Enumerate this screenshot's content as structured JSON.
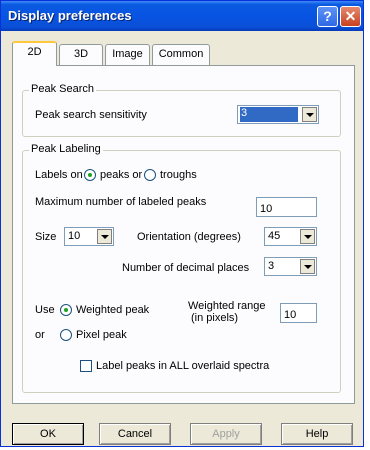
{
  "window": {
    "title": "Display preferences"
  },
  "tabs": [
    {
      "label": "2D",
      "active": true
    },
    {
      "label": "3D",
      "active": false
    },
    {
      "label": "Image",
      "active": false
    },
    {
      "label": "Common",
      "active": false
    }
  ],
  "peak_search": {
    "group_label": "Peak Search",
    "sensitivity_label": "Peak search sensitivity",
    "sensitivity_value": "3"
  },
  "peak_labeling": {
    "group_label": "Peak Labeling",
    "labels_on_label": "Labels on",
    "peaks_or_label": "peaks or",
    "troughs_label": "troughs",
    "max_peaks_label": "Maximum number of labeled peaks",
    "max_peaks_value": "10",
    "size_label": "Size",
    "size_value": "10",
    "orientation_label": "Orientation (degrees)",
    "orientation_value": "45",
    "decimal_label": "Number of decimal places",
    "decimal_value": "3",
    "use_label": "Use",
    "weighted_peak_label": "Weighted peak",
    "weighted_range_label_1": "Weighted range",
    "weighted_range_label_2": "(in pixels)",
    "weighted_range_value": "10",
    "or_label": "or",
    "pixel_peak_label": "Pixel peak",
    "label_all_label": "Label peaks in ALL overlaid spectra"
  },
  "buttons": {
    "ok": "OK",
    "cancel": "Cancel",
    "apply": "Apply",
    "help": "Help"
  },
  "colors": {
    "titlebar": "#0a5ae0",
    "selection": "#316ac5"
  }
}
